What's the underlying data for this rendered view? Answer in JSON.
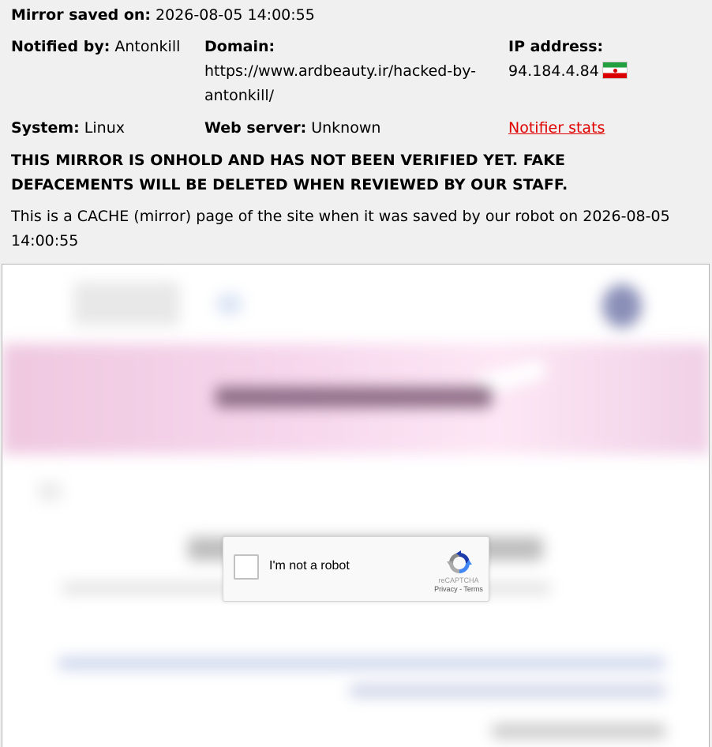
{
  "header": {
    "mirror_saved_label": "Mirror saved on:",
    "mirror_saved_value": "2026-08-05 14:00:55",
    "notified_by_label": "Notified by:",
    "notified_by_value": "Antonkill",
    "domain_label": "Domain:",
    "domain_line1": "https://www.ardbeauty.ir/hacked-by-",
    "domain_line2": "antonkill/",
    "ip_label": "IP address:",
    "ip_value": "94.184.4.84",
    "flag_icon": "iran-flag-icon",
    "system_label": "System:",
    "system_value": "Linux",
    "webserver_label": "Web server:",
    "webserver_value": "Unknown",
    "notifier_stats_link": "Notifier stats",
    "link_color": "#e00000",
    "warning_line1": "THIS MIRROR IS ONHOLD AND HAS NOT BEEN VERIFIED YET. FAKE",
    "warning_line2": "DEFACEMENTS WILL BE DELETED WHEN REVIEWED BY OUR STAFF.",
    "cache_line1": "This is a CACHE (mirror) page of the site when it was saved by our robot on 2026-08-05",
    "cache_line2": "14:00:55"
  },
  "recaptcha": {
    "label": "I'm not a robot",
    "brand": "reCAPTCHA",
    "privacy": "Privacy",
    "separator": " - ",
    "terms": "Terms",
    "icon": "recaptcha-logo-icon"
  }
}
